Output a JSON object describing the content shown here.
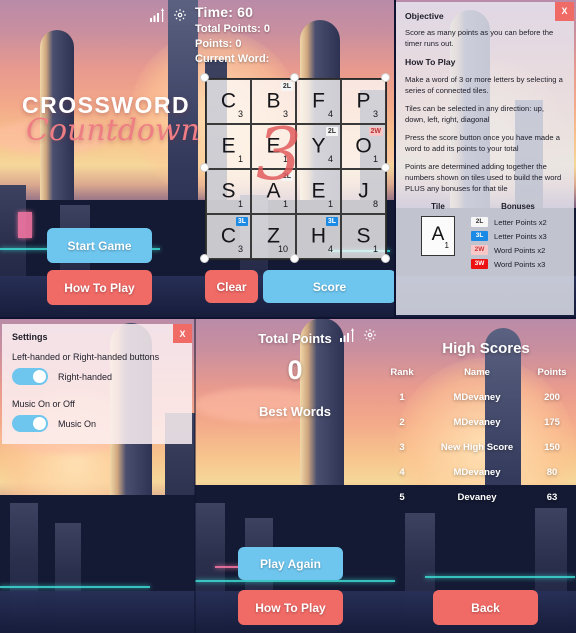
{
  "game": {
    "logo_line1": "CROSSWORD",
    "logo_line2": "Countdown",
    "hud": {
      "time": "Time: 60",
      "total_points": "Total Points: 0",
      "points": "Points: 0",
      "current_word": "Current Word:"
    },
    "icons": {
      "signal": "signal-bars-icon",
      "gear": "gear-icon"
    },
    "overlay_number": "3"
  },
  "board": {
    "rows": [
      [
        {
          "letter": "C",
          "value": "3",
          "bonus": null
        },
        {
          "letter": "B",
          "value": "3",
          "bonus": "2L",
          "bonus_pos": "right"
        },
        {
          "letter": "F",
          "value": "4",
          "bonus": null
        },
        {
          "letter": "P",
          "value": "3",
          "bonus": null
        }
      ],
      [
        {
          "letter": "E",
          "value": "1",
          "bonus": null
        },
        {
          "letter": "E",
          "value": "1",
          "bonus": null
        },
        {
          "letter": "Y",
          "value": "4",
          "bonus": "2L",
          "bonus_pos": "right"
        },
        {
          "letter": "O",
          "value": "1",
          "bonus": "2W",
          "bonus_pos": "right"
        }
      ],
      [
        {
          "letter": "S",
          "value": "1",
          "bonus": null
        },
        {
          "letter": "A",
          "value": "1",
          "bonus": "2L",
          "bonus_pos": "right"
        },
        {
          "letter": "E",
          "value": "1",
          "bonus": null
        },
        {
          "letter": "J",
          "value": "8",
          "bonus": null
        }
      ],
      [
        {
          "letter": "C",
          "value": "3",
          "bonus": "3L",
          "bonus_pos": "right"
        },
        {
          "letter": "Z",
          "value": "10",
          "bonus": null
        },
        {
          "letter": "H",
          "value": "4",
          "bonus": "3L",
          "bonus_pos": "right"
        },
        {
          "letter": "S",
          "value": "1",
          "bonus": null
        }
      ]
    ]
  },
  "buttons": {
    "start_game": "Start Game",
    "how_to_play": "How To Play",
    "clear": "Clear",
    "score": "Score",
    "play_again": "Play Again",
    "back": "Back"
  },
  "how_to_play": {
    "close": "X",
    "objective_heading": "Objective",
    "objective_text": "Score as many points as you can before the timer runs out.",
    "howto_heading": "How To Play",
    "p1": "Make a word of 3 or more letters by selecting a series of connected tiles.",
    "p2": "Tiles can be selected in any direction: up, down, left, right, diagonal",
    "p3": "Press the score button once you have made a word to add its points to your total",
    "p4": "Points are determined adding together the numbers shown on tiles used to build the word PLUS any bonuses for that tile",
    "tile_heading": "Tile",
    "bonuses_heading": "Bonuses",
    "sample_tile": {
      "letter": "A",
      "value": "1"
    },
    "bonus_rows": [
      {
        "chip": "2L",
        "label": "Letter Points x2",
        "color": "#f7f7f7"
      },
      {
        "chip": "3L",
        "label": "Letter Points x3",
        "color": "#1a8ae5"
      },
      {
        "chip": "2W",
        "label": "Word Points x2",
        "color": "#f8c8c8"
      },
      {
        "chip": "3W",
        "label": "Word Points x3",
        "color": "#ee1111"
      }
    ]
  },
  "settings": {
    "close": "X",
    "title": "Settings",
    "handed_label": "Left-handed or Right-handed buttons",
    "handed_value": "Right-handed",
    "music_label": "Music On or Off",
    "music_value": "Music On"
  },
  "results": {
    "total_points_label": "Total Points",
    "total_points_value": "0",
    "best_words_label": "Best Words"
  },
  "high_scores": {
    "title": "High Scores",
    "columns": [
      "Rank",
      "Name",
      "Points"
    ],
    "rows": [
      {
        "rank": "1",
        "name": "MDevaney",
        "points": "200"
      },
      {
        "rank": "2",
        "name": "MDevaney",
        "points": "175"
      },
      {
        "rank": "3",
        "name": "New High Score",
        "points": "150"
      },
      {
        "rank": "4",
        "name": "MDevaney",
        "points": "80"
      },
      {
        "rank": "5",
        "name": "Devaney",
        "points": "63"
      }
    ]
  },
  "theme": {
    "blue": "#6ec6ef",
    "red": "#f06a66",
    "accent_pink": "#ef7d84"
  }
}
